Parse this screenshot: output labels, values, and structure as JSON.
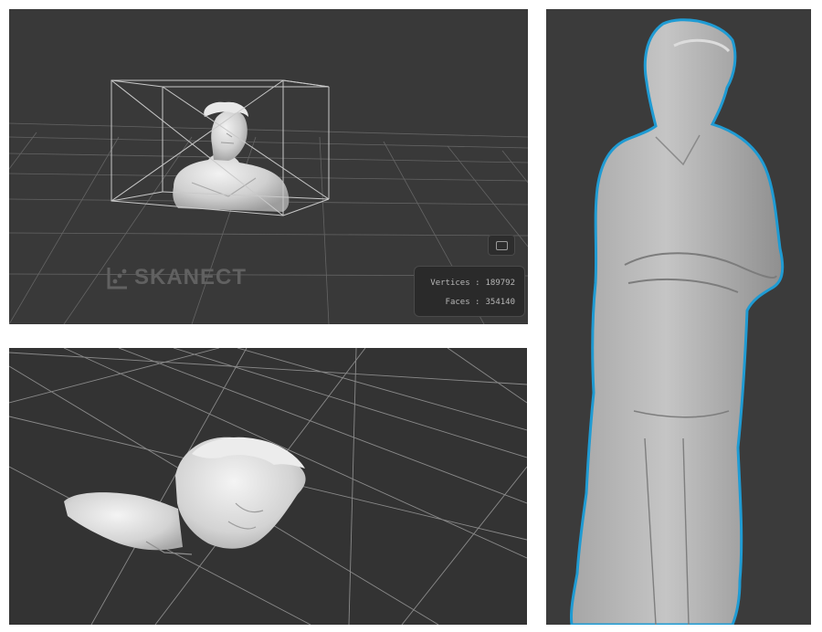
{
  "skanect_window": {
    "logo_text": "SKANECT",
    "stats": {
      "vertices_label": "Vertices :",
      "vertices_value": "189792",
      "faces_label": "Faces :",
      "faces_value": "354140"
    },
    "view_button_icon": "frame-icon"
  },
  "colors": {
    "viewport_background": "#393939",
    "grid_line": "#8a8a8a",
    "bounding_box": "#c8c8c8",
    "scan_mesh": "#d8d8d8",
    "selection_outline": "#1f9bd3"
  }
}
